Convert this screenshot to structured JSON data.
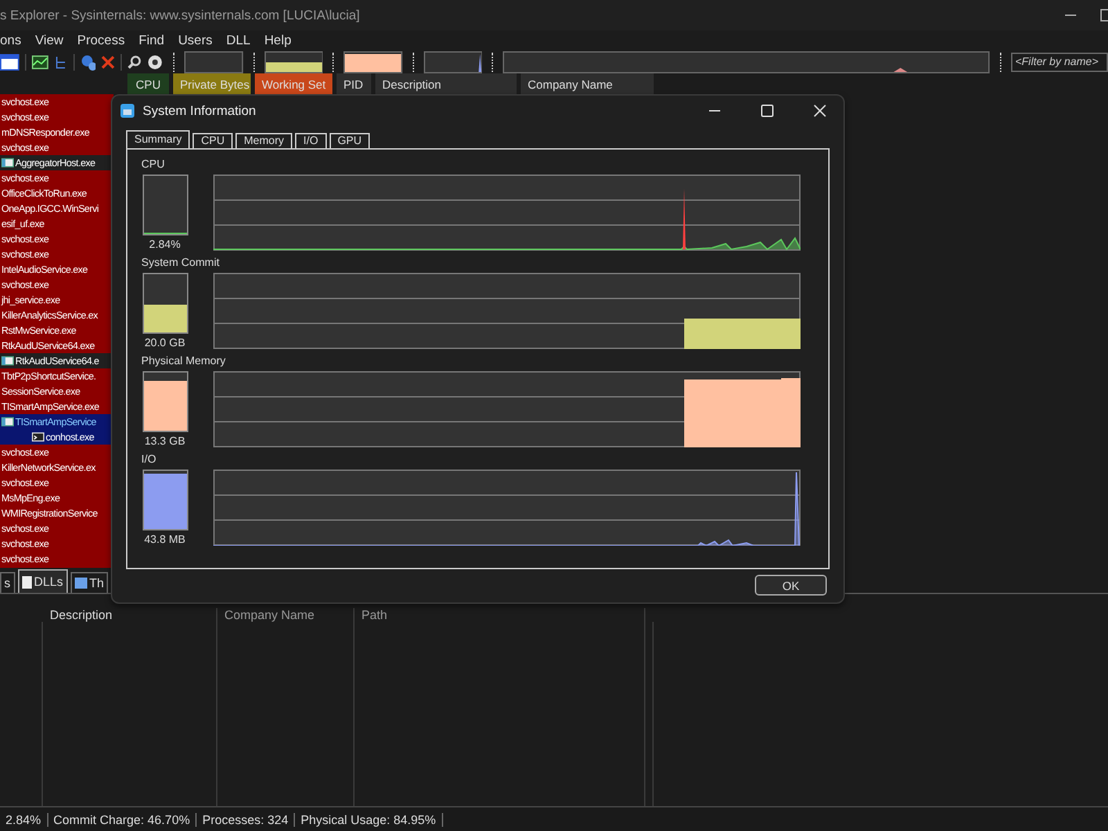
{
  "window": {
    "title": "s Explorer - Sysinternals: www.sysinternals.com [LUCIA\\lucia]"
  },
  "menu": [
    "ons",
    "View",
    "Process",
    "Find",
    "Users",
    "DLL",
    "Help"
  ],
  "filter": {
    "placeholder": "<Filter by name>"
  },
  "columns": [
    {
      "label": "CPU",
      "color": "#1f3f1f"
    },
    {
      "label": "Private Bytes",
      "color": "#8a7a12"
    },
    {
      "label": "Working Set",
      "color": "#c8471a"
    },
    {
      "label": "PID"
    },
    {
      "label": "Description"
    },
    {
      "label": "Company Name"
    }
  ],
  "processes": [
    {
      "name": "svchost.exe",
      "kind": "service",
      "selected": false
    },
    {
      "name": "svchost.exe",
      "kind": "service",
      "selected": false
    },
    {
      "name": "mDNSResponder.exe",
      "kind": "service",
      "selected": false
    },
    {
      "name": "svchost.exe",
      "kind": "service",
      "selected": false
    },
    {
      "name": "AggregatorHost.exe",
      "kind": "app",
      "selected": false
    },
    {
      "name": "svchost.exe",
      "kind": "service",
      "selected": false
    },
    {
      "name": "OfficeClickToRun.exe",
      "kind": "service",
      "selected": false
    },
    {
      "name": "OneApp.IGCC.WinServi",
      "kind": "service",
      "selected": false
    },
    {
      "name": "esif_uf.exe",
      "kind": "service",
      "selected": false
    },
    {
      "name": "svchost.exe",
      "kind": "service",
      "selected": false
    },
    {
      "name": "svchost.exe",
      "kind": "service",
      "selected": false
    },
    {
      "name": "IntelAudioService.exe",
      "kind": "service",
      "selected": false
    },
    {
      "name": "svchost.exe",
      "kind": "service",
      "selected": false
    },
    {
      "name": "jhi_service.exe",
      "kind": "service",
      "selected": false
    },
    {
      "name": "KillerAnalyticsService.ex",
      "kind": "service",
      "selected": false
    },
    {
      "name": "RstMwService.exe",
      "kind": "service",
      "selected": false
    },
    {
      "name": "RtkAudUService64.exe",
      "kind": "service",
      "selected": false
    },
    {
      "name": "RtkAudUService64.e",
      "kind": "app",
      "selected": false
    },
    {
      "name": "TbtP2pShortcutService.",
      "kind": "service",
      "selected": false
    },
    {
      "name": "SessionService.exe",
      "kind": "service",
      "selected": false
    },
    {
      "name": "TISmartAmpService.exe",
      "kind": "service",
      "selected": false
    },
    {
      "name": "TISmartAmpService",
      "kind": "app",
      "selected": true,
      "children": [
        {
          "name": "conhost.exe",
          "kind": "console",
          "selected": false
        }
      ]
    },
    {
      "name": "svchost.exe",
      "kind": "service",
      "selected": false
    },
    {
      "name": "KillerNetworkService.ex",
      "kind": "service",
      "selected": false
    },
    {
      "name": "svchost.exe",
      "kind": "service",
      "selected": false
    },
    {
      "name": "MsMpEng.exe",
      "kind": "service",
      "selected": false
    },
    {
      "name": "WMIRegistrationService",
      "kind": "service",
      "selected": false
    },
    {
      "name": "svchost.exe",
      "kind": "service",
      "selected": false
    },
    {
      "name": "svchost.exe",
      "kind": "service",
      "selected": false
    },
    {
      "name": "svchost.exe",
      "kind": "service",
      "selected": false
    }
  ],
  "lower_tabs": [
    {
      "label": "s",
      "selected": false
    },
    {
      "label": "DLLs",
      "selected": true
    },
    {
      "label": "Th",
      "selected": false
    }
  ],
  "lower_columns": [
    "Description",
    "Company Name",
    "Path"
  ],
  "status_bar": [
    "2.84%",
    "Commit Charge: 46.70%",
    "Processes: 324",
    "Physical Usage: 84.95%"
  ],
  "dialog": {
    "title": "System Information",
    "tabs": [
      {
        "label": "Summary",
        "selected": true
      },
      {
        "label": "CPU",
        "selected": false
      },
      {
        "label": "Memory",
        "selected": false
      },
      {
        "label": "I/O",
        "selected": false
      },
      {
        "label": "GPU",
        "selected": false
      }
    ],
    "meters": [
      {
        "label": "CPU",
        "kind": "cpu",
        "level": 0.03,
        "reading": "2.84%",
        "color": "#5cc85c"
      },
      {
        "label": "System Commit",
        "kind": "commit",
        "level": 0.47,
        "reading": "20.0 GB",
        "color": "#d2d47a"
      },
      {
        "label": "Physical Memory",
        "kind": "physical",
        "level": 0.86,
        "reading": "13.3 GB",
        "color": "#ffc0a0"
      },
      {
        "label": "I/O",
        "kind": "io",
        "level": 0.95,
        "reading": "43.8  MB",
        "color": "#8c9cf0"
      }
    ],
    "ok_button": "OK"
  }
}
